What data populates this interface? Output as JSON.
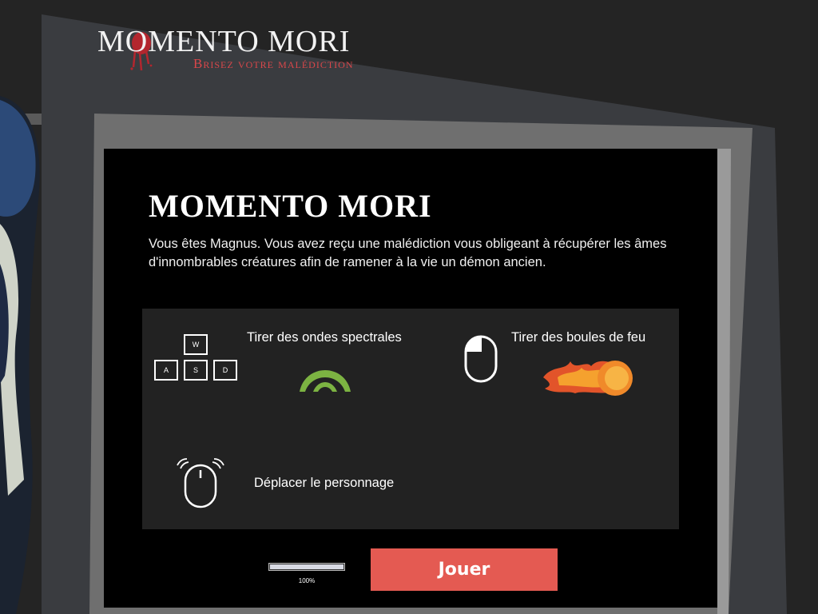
{
  "logo": {
    "title": "MOMENTO MORI",
    "subtitle": "Brisez votre malédiction"
  },
  "panel": {
    "title": "MOMENTO MORI",
    "description": "Vous êtes Magnus. Vous avez reçu une malédiction vous obligeant à récupérer les âmes d'innombrables créatures afin de ramener à la vie un démon ancien."
  },
  "controls": {
    "keys": [
      "W",
      "A",
      "S",
      "D"
    ],
    "keyboard_action": "Tirer des ondes spectrales",
    "mouse_click_action": "Tirer des boules de feu",
    "mouse_move_action": "Déplacer le personnage"
  },
  "loading": {
    "progress": 1.0,
    "percent_text": "100%"
  },
  "play_button": {
    "label": "Jouer"
  },
  "colors": {
    "accent": "#e45a52",
    "spectral_wave": "#7cb342",
    "fireball": "#f08a2a",
    "logo_subtitle": "#d9474a"
  }
}
